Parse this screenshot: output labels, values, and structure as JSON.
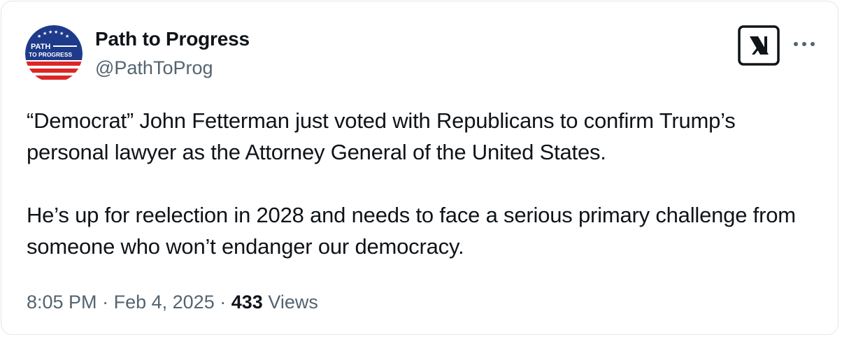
{
  "author": {
    "display_name": "Path to Progress",
    "handle": "@PathToProg",
    "avatar_text_line1": "PATH",
    "avatar_text_line2": "TO PROGRESS"
  },
  "tweet": {
    "paragraphs": [
      "“Democrat” John Fetterman just voted with Republicans to confirm Trump’s personal lawyer as the Attorney General of the United States.",
      "He’s up for reelection in 2028 and needs to face a serious primary challenge from someone who won’t endanger our democracy."
    ]
  },
  "meta": {
    "time": "8:05 PM",
    "separator": "·",
    "date": "Feb 4, 2025",
    "views_count": "433",
    "views_label": "Views"
  },
  "icons": {
    "platform_logo": "x-logo-icon",
    "more": "more-options-icon"
  },
  "colors": {
    "avatar_blue": "#1e3a8a",
    "avatar_red": "#dc2626",
    "text_primary": "#0f1419",
    "text_secondary": "#536471"
  }
}
